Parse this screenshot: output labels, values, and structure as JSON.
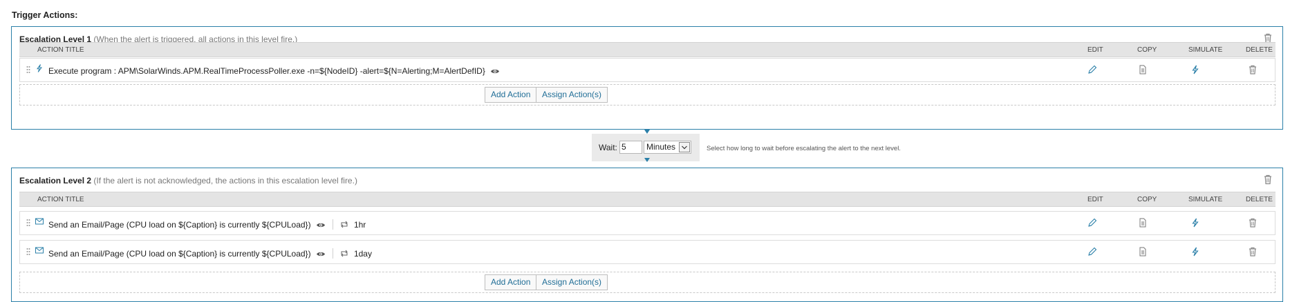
{
  "page": {
    "title": "Trigger Actions:"
  },
  "columns": {
    "title": "ACTION TITLE",
    "edit": "EDIT",
    "copy": "COPY",
    "simulate": "SIMULATE",
    "delete": "DELETE"
  },
  "level1": {
    "name": "Escalation Level 1",
    "description": "(When the alert is triggered, all actions in this level fire.)",
    "actions": [
      {
        "title": "Execute program : APM\\SolarWinds.APM.RealTimeProcessPoller.exe -n=${NodeID} -alert=${N=Alerting;M=AlertDefID}",
        "type_icon": "lightning-icon"
      }
    ],
    "add_action": "Add Action",
    "assign_actions": "Assign Action(s)"
  },
  "wait": {
    "label": "Wait:",
    "value": "5",
    "unit": "Minutes",
    "hint": "Select how long to wait before escalating the alert to the next level."
  },
  "level2": {
    "name": "Escalation Level 2",
    "description": "(If the alert is not acknowledged, the actions in this escalation level fire.)",
    "actions": [
      {
        "title": "Send an Email/Page (CPU load on ${Caption} is currently ${CPULoad})",
        "repeat": "1hr",
        "type_icon": "envelope-icon"
      },
      {
        "title": "Send an Email/Page (CPU load on ${Caption} is currently ${CPULoad})",
        "repeat": "1day",
        "type_icon": "envelope-icon"
      }
    ],
    "add_action": "Add Action",
    "assign_actions": "Assign Action(s)"
  },
  "colors": {
    "accent": "#2a7fa8",
    "link": "#1f6d96",
    "header_bg": "#e4e4e4"
  }
}
